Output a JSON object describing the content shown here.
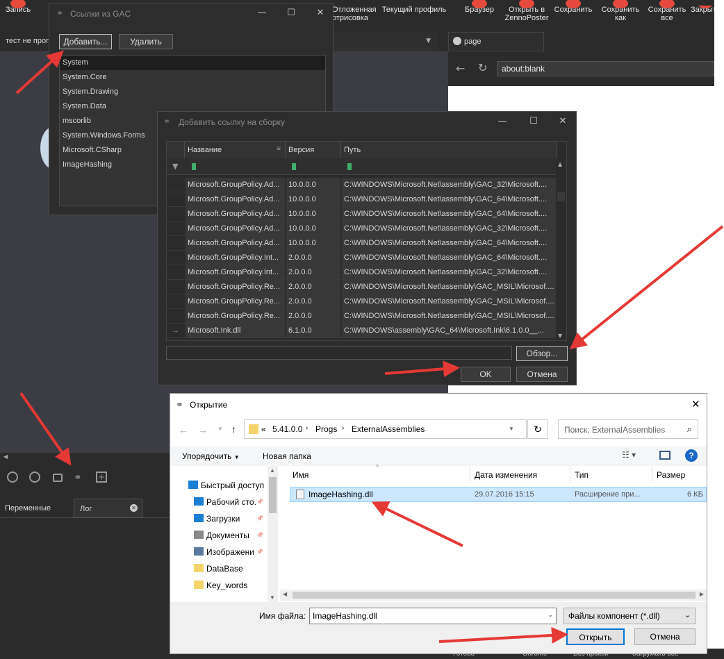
{
  "app": {
    "toolbar": [
      {
        "label": "Запись",
        "color": "#e64a3c"
      },
      {
        "label": "Отложенная\nотрисовка",
        "color": "#3fae6a"
      },
      {
        "label": "Текущий профиль",
        "color": "#3fae6a"
      },
      {
        "label": "Браузер",
        "color": "#e64a3c"
      },
      {
        "label": "Открыть в\nZennoPoster",
        "color": "#e64a3c"
      },
      {
        "label": "Сохранить",
        "color": "#e64a3c"
      },
      {
        "label": "Сохранить\nкак",
        "color": "#e64a3c"
      },
      {
        "label": "Сохранить\nвсе",
        "color": "#e64a3c"
      },
      {
        "label": "Закрыть",
        "color": "#e64a3c"
      }
    ],
    "tab_label": "тест не прог",
    "browser_tab": "page",
    "address": "about:blank",
    "bottom_tabs": {
      "variables": "Переменные",
      "log": "Лог"
    },
    "status": {
      "ready": "Готово",
      "chrome": "Chrome",
      "no_proxy": "Без прокси",
      "load_all": "Загружать все"
    }
  },
  "gac_dialog": {
    "title": "Ссылки из GAC",
    "add_button": "Добавить...",
    "remove_button": "Удалить",
    "items": [
      "System",
      "System.Core",
      "System.Drawing",
      "System.Data",
      "mscorlib",
      "System.Windows.Forms",
      "Microsoft.CSharp",
      "ImageHashing"
    ]
  },
  "addref_dialog": {
    "title": "Добавить ссылку на сборку",
    "columns": {
      "name": "Название",
      "version": "Версия",
      "path": "Путь"
    },
    "rows": [
      {
        "name": "Microsoft.GroupPolicy.Ad...",
        "version": "10.0.0.0",
        "path": "C:\\WINDOWS\\Microsoft.Net\\assembly\\GAC_32\\Microsoft...."
      },
      {
        "name": "Microsoft.GroupPolicy.Ad...",
        "version": "10.0.0.0",
        "path": "C:\\WINDOWS\\Microsoft.Net\\assembly\\GAC_64\\Microsoft...."
      },
      {
        "name": "Microsoft.GroupPolicy.Ad...",
        "version": "10.0.0.0",
        "path": "C:\\WINDOWS\\Microsoft.Net\\assembly\\GAC_64\\Microsoft...."
      },
      {
        "name": "Microsoft.GroupPolicy.Ad...",
        "version": "10.0.0.0",
        "path": "C:\\WINDOWS\\Microsoft.Net\\assembly\\GAC_32\\Microsoft...."
      },
      {
        "name": "Microsoft.GroupPolicy.Ad...",
        "version": "10.0.0.0",
        "path": "C:\\WINDOWS\\Microsoft.Net\\assembly\\GAC_64\\Microsoft...."
      },
      {
        "name": "Microsoft.GroupPolicy.Int...",
        "version": "2.0.0.0",
        "path": "C:\\WINDOWS\\Microsoft.Net\\assembly\\GAC_64\\Microsoft...."
      },
      {
        "name": "Microsoft.GroupPolicy.Int...",
        "version": "2.0.0.0",
        "path": "C:\\WINDOWS\\Microsoft.Net\\assembly\\GAC_32\\Microsoft...."
      },
      {
        "name": "Microsoft.GroupPolicy.Re...",
        "version": "2.0.0.0",
        "path": "C:\\WINDOWS\\Microsoft.Net\\assembly\\GAC_MSIL\\Microsof...."
      },
      {
        "name": "Microsoft.GroupPolicy.Re...",
        "version": "2.0.0.0",
        "path": "C:\\WINDOWS\\Microsoft.Net\\assembly\\GAC_MSIL\\Microsof...."
      },
      {
        "name": "Microsoft.GroupPolicy.Re...",
        "version": "2.0.0.0",
        "path": "C:\\WINDOWS\\Microsoft.Net\\assembly\\GAC_MSIL\\Microsof...."
      },
      {
        "name": "Microsoft.Ink.dll",
        "version": "6.1.0.0",
        "path": "C:\\WINDOWS\\assembly\\GAC_64\\Microsoft.Ink\\6.1.0.0__..."
      }
    ],
    "browse_button": "Обзор...",
    "ok_button": "OK",
    "cancel_button": "Отмена"
  },
  "open_dialog": {
    "title": "Открытие",
    "breadcrumb": [
      "«",
      "5.41.0.0",
      "Progs",
      "ExternalAssemblies"
    ],
    "search_placeholder": "Поиск: ExternalAssemblies",
    "organize": "Упорядочить",
    "new_folder": "Новая папка",
    "nav": [
      {
        "label": "Быстрый доступ",
        "icon": "star-icon",
        "color": "#1a7fd5"
      },
      {
        "label": "Рабочий сто.",
        "icon": "desktop-icon",
        "color": "#1a7fd5"
      },
      {
        "label": "Загрузки",
        "icon": "download-icon",
        "color": "#1a7fd5"
      },
      {
        "label": "Документы",
        "icon": "documents-icon",
        "color": "#8a8a8a"
      },
      {
        "label": "Изображени",
        "icon": "pictures-icon",
        "color": "#5a7aa0"
      },
      {
        "label": "DataBase",
        "icon": "folder-icon",
        "color": "#f5d36b"
      },
      {
        "label": "Key_words",
        "icon": "folder-icon",
        "color": "#f5d36b"
      }
    ],
    "columns": {
      "name": "Имя",
      "date": "Дата изменения",
      "type": "Тип",
      "size": "Размер"
    },
    "file": {
      "name": "ImageHashing.dll",
      "date": "29.07.2016 15:15",
      "type": "Расширение при...",
      "size": "6 КБ"
    },
    "filename_label": "Имя файла:",
    "filename_value": "ImageHashing.dll",
    "filter": "Файлы компонент (*.dll)",
    "open_button": "Открыть",
    "cancel_button": "Отмена"
  }
}
